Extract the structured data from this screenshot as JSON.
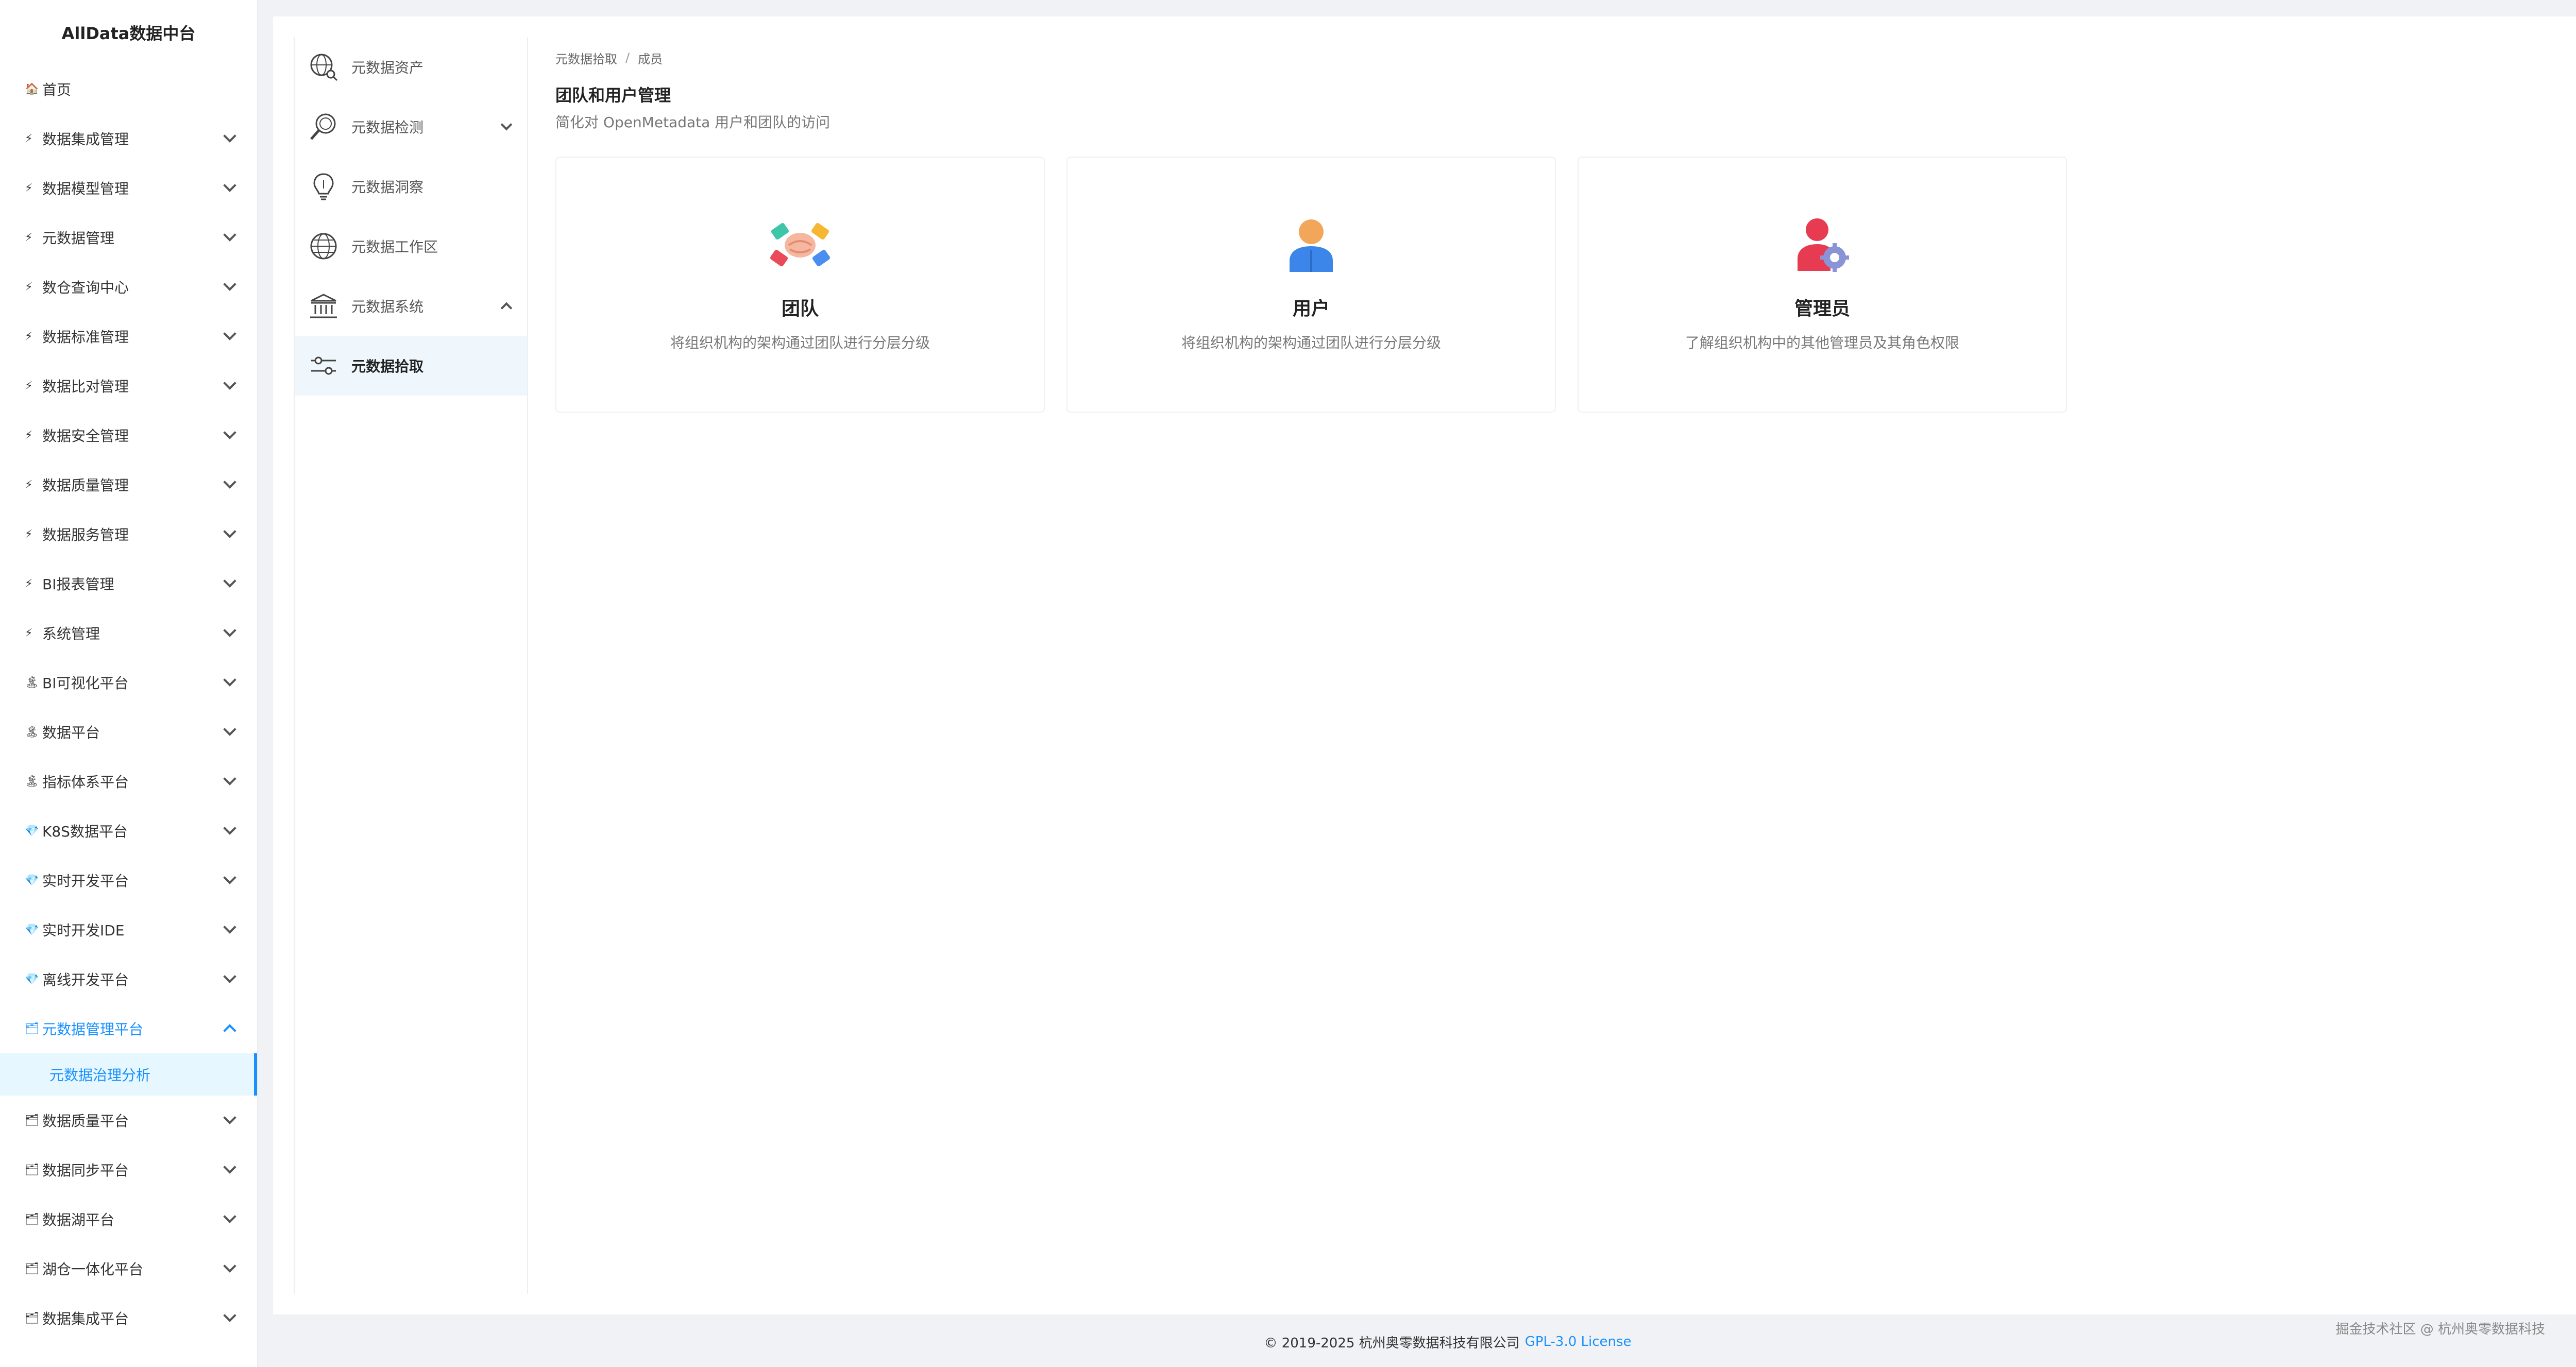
{
  "sidebar": {
    "brand": "AllData数据中台",
    "items": [
      {
        "emoji": "🏠",
        "label": "首页",
        "chevron": false
      },
      {
        "emoji": "⚡",
        "label": "数据集成管理",
        "chevron": true
      },
      {
        "emoji": "⚡",
        "label": "数据模型管理",
        "chevron": true
      },
      {
        "emoji": "⚡",
        "label": "元数据管理",
        "chevron": true
      },
      {
        "emoji": "⚡",
        "label": "数仓查询中心",
        "chevron": true
      },
      {
        "emoji": "⚡",
        "label": "数据标准管理",
        "chevron": true
      },
      {
        "emoji": "⚡",
        "label": "数据比对管理",
        "chevron": true
      },
      {
        "emoji": "⚡",
        "label": "数据安全管理",
        "chevron": true
      },
      {
        "emoji": "⚡",
        "label": "数据质量管理",
        "chevron": true
      },
      {
        "emoji": "⚡",
        "label": "数据服务管理",
        "chevron": true
      },
      {
        "emoji": "⚡",
        "label": "BI报表管理",
        "chevron": true
      },
      {
        "emoji": "⚡",
        "label": "系统管理",
        "chevron": true
      },
      {
        "emoji": "🏝",
        "label": "BI可视化平台",
        "chevron": true
      },
      {
        "emoji": "🏝",
        "label": "数据平台",
        "chevron": true
      },
      {
        "emoji": "🏝",
        "label": "指标体系平台",
        "chevron": true
      },
      {
        "emoji": "💎",
        "label": "K8S数据平台",
        "chevron": true
      },
      {
        "emoji": "💎",
        "label": "实时开发平台",
        "chevron": true
      },
      {
        "emoji": "💎",
        "label": "实时开发IDE",
        "chevron": true
      },
      {
        "emoji": "💎",
        "label": "离线开发平台",
        "chevron": true
      },
      {
        "emoji": "🗂",
        "label": "元数据管理平台",
        "chevron": true,
        "open": true
      },
      {
        "emoji": "🗂",
        "label": "数据质量平台",
        "chevron": true
      },
      {
        "emoji": "🗂",
        "label": "数据同步平台",
        "chevron": true
      },
      {
        "emoji": "🗂",
        "label": "数据湖平台",
        "chevron": true
      },
      {
        "emoji": "🗂",
        "label": "湖仓一体化平台",
        "chevron": true
      },
      {
        "emoji": "🗂",
        "label": "数据集成平台",
        "chevron": true
      }
    ],
    "active_sub": "元数据治理分析"
  },
  "submenu": {
    "items": [
      {
        "icon": "globe-search-icon",
        "label": "元数据资产"
      },
      {
        "icon": "magnifier-icon",
        "label": "元数据检测"
      },
      {
        "icon": "lightbulb-icon",
        "label": "元数据洞察"
      },
      {
        "icon": "globe-icon",
        "label": "元数据工作区"
      },
      {
        "icon": "bank-icon",
        "label": "元数据系统"
      },
      {
        "icon": "sliders-icon",
        "label": "元数据拾取"
      }
    ]
  },
  "content": {
    "breadcrumb": [
      "元数据拾取",
      "成员"
    ],
    "title": "团队和用户管理",
    "description": "简化对 OpenMetadata 用户和团队的访问",
    "cards": [
      {
        "icon": "team-handshake-icon",
        "title": "团队",
        "desc": "将组织机构的架构通过团队进行分层分级"
      },
      {
        "icon": "user-icon",
        "title": "用户",
        "desc": "将组织机构的架构通过团队进行分层分级"
      },
      {
        "icon": "admin-gear-icon",
        "title": "管理员",
        "desc": "了解组织机构中的其他管理员及其角色权限"
      }
    ]
  },
  "footer": {
    "copyright": "© 2019-2025 杭州奥零数据科技有限公司",
    "license": "GPL-3.0 License",
    "watermark": "掘金技术社区 @ 杭州奥零数据科技"
  },
  "colors": {
    "accent": "#1890ff",
    "active_bg": "#e6f7ff"
  }
}
